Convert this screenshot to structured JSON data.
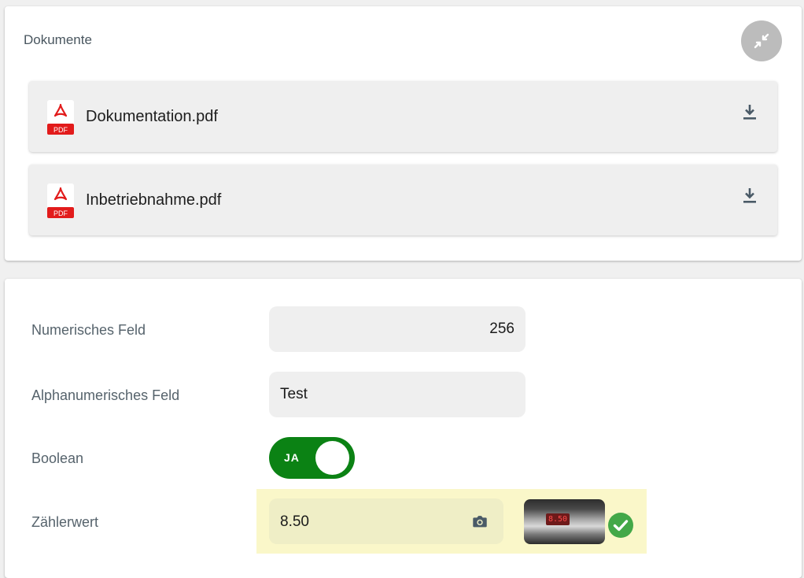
{
  "documents": {
    "title": "Dokumente",
    "collapse_icon": "collapse-arrows-icon",
    "items": [
      {
        "name": "Dokumentation.pdf",
        "file_icon": "pdf-file-icon",
        "file_badge": "PDF",
        "action_icon": "download-icon"
      },
      {
        "name": "Inbetriebnahme.pdf",
        "file_icon": "pdf-file-icon",
        "file_badge": "PDF",
        "action_icon": "download-icon"
      }
    ]
  },
  "form": {
    "numeric": {
      "label": "Numerisches Feld",
      "value": "256"
    },
    "alphanumeric": {
      "label": "Alphanumerisches Feld",
      "value": "Test"
    },
    "boolean": {
      "label": "Boolean",
      "toggle_text": "JA",
      "checked": true
    },
    "meter": {
      "label": "Zählerwert",
      "value": "8.50",
      "camera_icon": "camera-icon",
      "photo_display": "8.50",
      "status_icon": "check-circle-icon"
    }
  },
  "colors": {
    "toggle_on": "#0b8214",
    "pdf_red": "#e21b1b",
    "check_green": "#43a848",
    "highlight": "#faf7c9",
    "collapse_button": "#bcbcbc"
  }
}
